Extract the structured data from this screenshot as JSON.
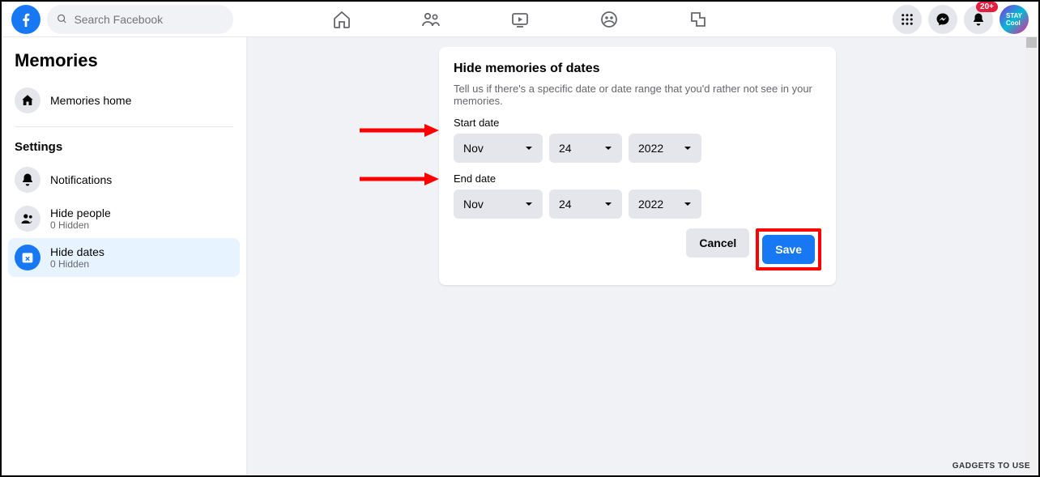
{
  "header": {
    "search_placeholder": "Search Facebook",
    "notification_badge": "20+"
  },
  "sidebar": {
    "title": "Memories",
    "memories_home": "Memories home",
    "settings_heading": "Settings",
    "notifications": "Notifications",
    "hide_people": {
      "label": "Hide people",
      "sub": "0 Hidden"
    },
    "hide_dates": {
      "label": "Hide dates",
      "sub": "0 Hidden"
    }
  },
  "card": {
    "title": "Hide memories of dates",
    "desc": "Tell us if there's a specific date or date range that you'd rather not see in your memories.",
    "start_label": "Start date",
    "end_label": "End date",
    "start": {
      "month": "Nov",
      "day": "24",
      "year": "2022"
    },
    "end": {
      "month": "Nov",
      "day": "24",
      "year": "2022"
    },
    "cancel": "Cancel",
    "save": "Save"
  },
  "watermark": "GADGETS TO USE"
}
